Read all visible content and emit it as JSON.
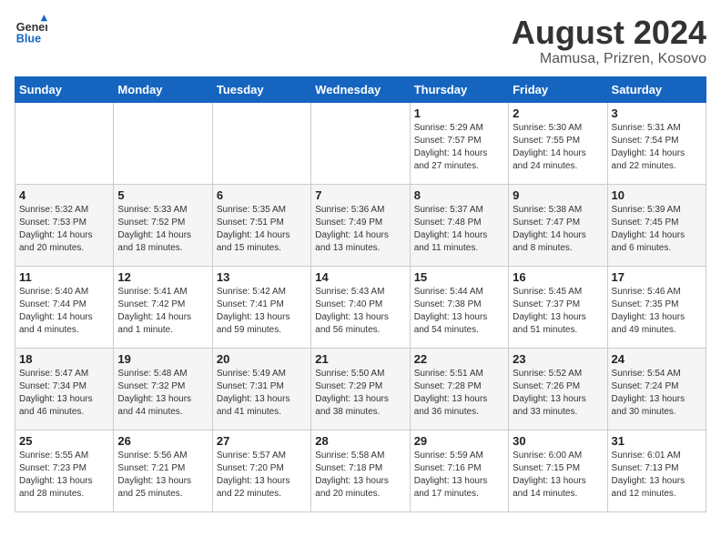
{
  "header": {
    "logo_line1": "General",
    "logo_line2": "Blue",
    "month_year": "August 2024",
    "location": "Mamusa, Prizren, Kosovo"
  },
  "weekdays": [
    "Sunday",
    "Monday",
    "Tuesday",
    "Wednesday",
    "Thursday",
    "Friday",
    "Saturday"
  ],
  "weeks": [
    [
      {
        "day": "",
        "info": ""
      },
      {
        "day": "",
        "info": ""
      },
      {
        "day": "",
        "info": ""
      },
      {
        "day": "",
        "info": ""
      },
      {
        "day": "1",
        "info": "Sunrise: 5:29 AM\nSunset: 7:57 PM\nDaylight: 14 hours\nand 27 minutes."
      },
      {
        "day": "2",
        "info": "Sunrise: 5:30 AM\nSunset: 7:55 PM\nDaylight: 14 hours\nand 24 minutes."
      },
      {
        "day": "3",
        "info": "Sunrise: 5:31 AM\nSunset: 7:54 PM\nDaylight: 14 hours\nand 22 minutes."
      }
    ],
    [
      {
        "day": "4",
        "info": "Sunrise: 5:32 AM\nSunset: 7:53 PM\nDaylight: 14 hours\nand 20 minutes."
      },
      {
        "day": "5",
        "info": "Sunrise: 5:33 AM\nSunset: 7:52 PM\nDaylight: 14 hours\nand 18 minutes."
      },
      {
        "day": "6",
        "info": "Sunrise: 5:35 AM\nSunset: 7:51 PM\nDaylight: 14 hours\nand 15 minutes."
      },
      {
        "day": "7",
        "info": "Sunrise: 5:36 AM\nSunset: 7:49 PM\nDaylight: 14 hours\nand 13 minutes."
      },
      {
        "day": "8",
        "info": "Sunrise: 5:37 AM\nSunset: 7:48 PM\nDaylight: 14 hours\nand 11 minutes."
      },
      {
        "day": "9",
        "info": "Sunrise: 5:38 AM\nSunset: 7:47 PM\nDaylight: 14 hours\nand 8 minutes."
      },
      {
        "day": "10",
        "info": "Sunrise: 5:39 AM\nSunset: 7:45 PM\nDaylight: 14 hours\nand 6 minutes."
      }
    ],
    [
      {
        "day": "11",
        "info": "Sunrise: 5:40 AM\nSunset: 7:44 PM\nDaylight: 14 hours\nand 4 minutes."
      },
      {
        "day": "12",
        "info": "Sunrise: 5:41 AM\nSunset: 7:42 PM\nDaylight: 14 hours\nand 1 minute."
      },
      {
        "day": "13",
        "info": "Sunrise: 5:42 AM\nSunset: 7:41 PM\nDaylight: 13 hours\nand 59 minutes."
      },
      {
        "day": "14",
        "info": "Sunrise: 5:43 AM\nSunset: 7:40 PM\nDaylight: 13 hours\nand 56 minutes."
      },
      {
        "day": "15",
        "info": "Sunrise: 5:44 AM\nSunset: 7:38 PM\nDaylight: 13 hours\nand 54 minutes."
      },
      {
        "day": "16",
        "info": "Sunrise: 5:45 AM\nSunset: 7:37 PM\nDaylight: 13 hours\nand 51 minutes."
      },
      {
        "day": "17",
        "info": "Sunrise: 5:46 AM\nSunset: 7:35 PM\nDaylight: 13 hours\nand 49 minutes."
      }
    ],
    [
      {
        "day": "18",
        "info": "Sunrise: 5:47 AM\nSunset: 7:34 PM\nDaylight: 13 hours\nand 46 minutes."
      },
      {
        "day": "19",
        "info": "Sunrise: 5:48 AM\nSunset: 7:32 PM\nDaylight: 13 hours\nand 44 minutes."
      },
      {
        "day": "20",
        "info": "Sunrise: 5:49 AM\nSunset: 7:31 PM\nDaylight: 13 hours\nand 41 minutes."
      },
      {
        "day": "21",
        "info": "Sunrise: 5:50 AM\nSunset: 7:29 PM\nDaylight: 13 hours\nand 38 minutes."
      },
      {
        "day": "22",
        "info": "Sunrise: 5:51 AM\nSunset: 7:28 PM\nDaylight: 13 hours\nand 36 minutes."
      },
      {
        "day": "23",
        "info": "Sunrise: 5:52 AM\nSunset: 7:26 PM\nDaylight: 13 hours\nand 33 minutes."
      },
      {
        "day": "24",
        "info": "Sunrise: 5:54 AM\nSunset: 7:24 PM\nDaylight: 13 hours\nand 30 minutes."
      }
    ],
    [
      {
        "day": "25",
        "info": "Sunrise: 5:55 AM\nSunset: 7:23 PM\nDaylight: 13 hours\nand 28 minutes."
      },
      {
        "day": "26",
        "info": "Sunrise: 5:56 AM\nSunset: 7:21 PM\nDaylight: 13 hours\nand 25 minutes."
      },
      {
        "day": "27",
        "info": "Sunrise: 5:57 AM\nSunset: 7:20 PM\nDaylight: 13 hours\nand 22 minutes."
      },
      {
        "day": "28",
        "info": "Sunrise: 5:58 AM\nSunset: 7:18 PM\nDaylight: 13 hours\nand 20 minutes."
      },
      {
        "day": "29",
        "info": "Sunrise: 5:59 AM\nSunset: 7:16 PM\nDaylight: 13 hours\nand 17 minutes."
      },
      {
        "day": "30",
        "info": "Sunrise: 6:00 AM\nSunset: 7:15 PM\nDaylight: 13 hours\nand 14 minutes."
      },
      {
        "day": "31",
        "info": "Sunrise: 6:01 AM\nSunset: 7:13 PM\nDaylight: 13 hours\nand 12 minutes."
      }
    ]
  ]
}
